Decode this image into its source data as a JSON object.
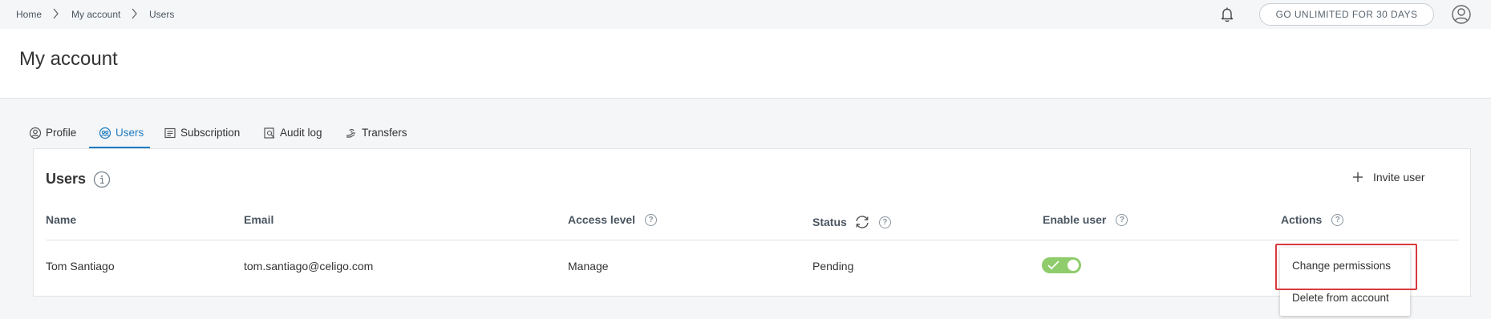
{
  "breadcrumb": {
    "items": [
      "Home",
      "My account",
      "Users"
    ]
  },
  "topbar": {
    "unlimited_label": "GO UNLIMITED FOR 30 DAYS",
    "icons": [
      "bell-icon",
      "user-avatar-icon"
    ]
  },
  "page": {
    "title": "My account"
  },
  "tabs": [
    {
      "label": "Profile",
      "icon": "profile-icon",
      "active": false
    },
    {
      "label": "Users",
      "icon": "users-icon",
      "active": true
    },
    {
      "label": "Subscription",
      "icon": "subscription-icon",
      "active": false
    },
    {
      "label": "Audit log",
      "icon": "audit-log-icon",
      "active": false
    },
    {
      "label": "Transfers",
      "icon": "transfers-icon",
      "active": false
    }
  ],
  "users_panel": {
    "title": "Users",
    "invite_label": "Invite user",
    "columns": {
      "name": "Name",
      "email": "Email",
      "access": "Access level",
      "status": "Status",
      "enable": "Enable user",
      "actions": "Actions"
    },
    "rows": [
      {
        "name": "Tom Santiago",
        "email": "tom.santiago@celigo.com",
        "access": "Manage",
        "status": "Pending",
        "enabled": true
      }
    ]
  },
  "actions_menu": {
    "items": [
      "Change permissions",
      "Delete from account"
    ]
  },
  "colors": {
    "accent": "#1f7cc2",
    "toggle_on": "#8fcc6b",
    "highlight": "#d9393e"
  }
}
